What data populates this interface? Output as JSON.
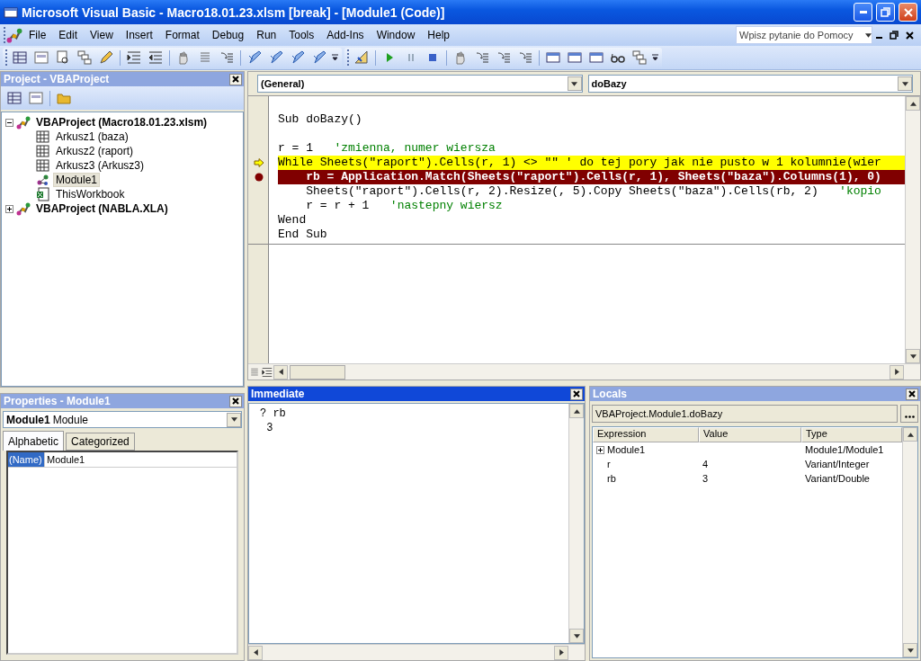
{
  "window": {
    "title": "Microsoft Visual Basic - Macro18.01.23.xlsm [break] - [Module1 (Code)]"
  },
  "menu": [
    "File",
    "Edit",
    "View",
    "Insert",
    "Format",
    "Debug",
    "Run",
    "Tools",
    "Add-Ins",
    "Window",
    "Help"
  ],
  "help_box": {
    "placeholder": "Wpisz pytanie do Pomocy"
  },
  "project": {
    "title": "Project - VBAProject",
    "active": false,
    "tree": [
      {
        "label": "VBAProject (Macro18.01.23.xlsm)",
        "kind": "project",
        "expanded": true,
        "selected": false,
        "children": [
          {
            "label": "Arkusz1 (baza)",
            "kind": "sheet",
            "selected": false
          },
          {
            "label": "Arkusz2 (raport)",
            "kind": "sheet",
            "selected": false
          },
          {
            "label": "Arkusz3 (Arkusz3)",
            "kind": "sheet",
            "selected": false
          },
          {
            "label": "Module1",
            "kind": "module",
            "selected": true
          },
          {
            "label": "ThisWorkbook",
            "kind": "workbook",
            "selected": false
          }
        ]
      },
      {
        "label": "VBAProject (NABLA.XLA)",
        "kind": "project",
        "expanded": false,
        "selected": false
      }
    ]
  },
  "code": {
    "object": "(General)",
    "procedure": "doBazy",
    "lines": [
      {
        "current": false,
        "breakpoint": false,
        "segments": [
          {
            "text": "Sub doBazy()",
            "kind": "code"
          }
        ]
      },
      {
        "current": false,
        "breakpoint": false
      },
      {
        "current": false,
        "breakpoint": false,
        "segments": [
          {
            "text": "r = 1   ",
            "kind": "code"
          },
          {
            "text": "'zmienna, numer wiersza",
            "kind": "comment"
          }
        ]
      },
      {
        "current": true,
        "breakpoint": false,
        "segments": [
          {
            "text": "While Sheets(\"raport\").Cells(r, 1) <> \"\" ",
            "kind": "code"
          },
          {
            "text": "' do tej pory jak nie pusto w 1 kolumnie(wier",
            "kind": "comment"
          }
        ]
      },
      {
        "current": false,
        "breakpoint": true,
        "segments": [
          {
            "text": "    rb = Application.Match(Sheets(\"raport\").Cells(r, 1), Sheets(\"baza\").Columns(1), 0)",
            "kind": "code"
          }
        ]
      },
      {
        "current": false,
        "breakpoint": false,
        "segments": [
          {
            "text": "    Sheets(\"raport\").Cells(r, 2).Resize(, 5).Copy Sheets(\"baza\").Cells(rb, 2)   ",
            "kind": "code"
          },
          {
            "text": "'kopio",
            "kind": "comment"
          }
        ]
      },
      {
        "current": false,
        "breakpoint": false,
        "segments": [
          {
            "text": "    r = r + 1   ",
            "kind": "code"
          },
          {
            "text": "'nastepny wiersz",
            "kind": "comment"
          }
        ]
      },
      {
        "current": false,
        "breakpoint": false,
        "segments": [
          {
            "text": "Wend",
            "kind": "code"
          }
        ]
      },
      {
        "current": false,
        "breakpoint": false,
        "segments": [
          {
            "text": "End Sub",
            "kind": "code"
          }
        ]
      }
    ]
  },
  "properties": {
    "title": "Properties - Module1",
    "active": false,
    "object": {
      "name": "Module1",
      "type": "Module"
    },
    "tabs": [
      {
        "label": "Alphabetic",
        "selected": true
      },
      {
        "label": "Categorized",
        "selected": false
      }
    ],
    "rows": [
      {
        "name": "(Name)",
        "value": "Module1",
        "selected": true
      }
    ]
  },
  "immediate": {
    "title": "Immediate",
    "active": true,
    "lines": [
      "? rb",
      " 3"
    ]
  },
  "locals": {
    "title": "Locals",
    "active": false,
    "context": "VBAProject.Module1.doBazy",
    "columns": [
      "Expression",
      "Value",
      "Type"
    ],
    "rows": [
      {
        "expression": "Module1",
        "type": "Module1/Module1",
        "expandable": true
      },
      {
        "expression": "r",
        "value": "4",
        "type": "Variant/Integer",
        "expandable": false
      },
      {
        "expression": "rb",
        "value": "3",
        "type": "Variant/Double",
        "expandable": false
      }
    ]
  }
}
